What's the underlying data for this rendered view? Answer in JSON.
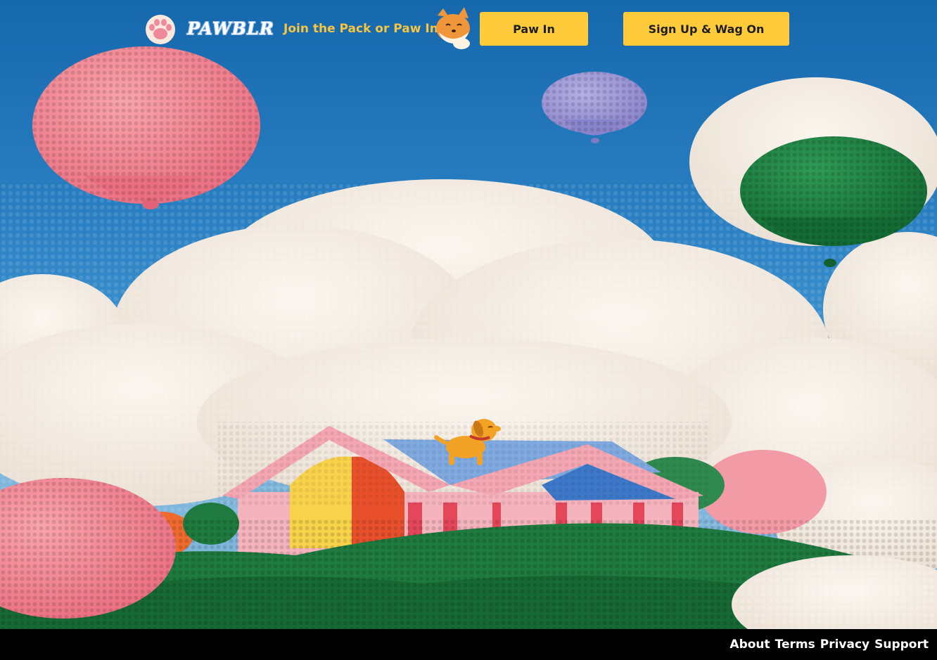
{
  "header": {
    "brand": "PAWBLR",
    "tagline": "Join the Pack or Paw In!",
    "login_label": "Paw In",
    "signup_label": "Sign Up & Wag On"
  },
  "footer": {
    "links": [
      "About",
      "Terms",
      "Privacy",
      "Support"
    ]
  },
  "colors": {
    "accent_button": "#ffcb3a",
    "tagline": "#f7c542",
    "footer_bg": "#000000",
    "sky": "#1d6fb0"
  },
  "icons": {
    "logo": "paw-icon",
    "mascot": "shiba-icon",
    "scene_dog": "dog-icon"
  }
}
